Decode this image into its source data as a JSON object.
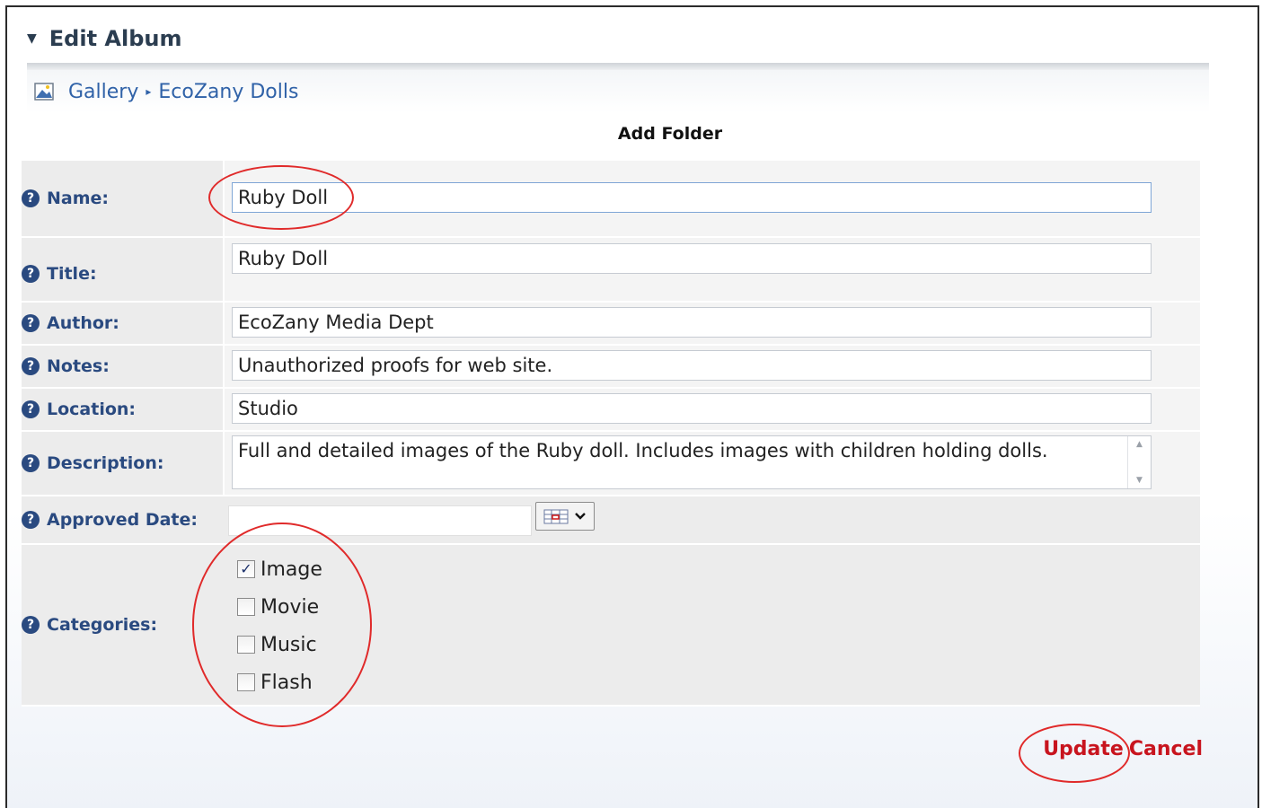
{
  "header": {
    "caret": "▼",
    "title": "Edit Album"
  },
  "breadcrumb": {
    "items": [
      "Gallery",
      "EcoZany Dolls"
    ],
    "separator": "▸"
  },
  "form": {
    "title": "Add Folder",
    "fields": {
      "name": {
        "label": "Name:",
        "value": "Ruby Doll"
      },
      "title": {
        "label": "Title:",
        "value": "Ruby Doll"
      },
      "author": {
        "label": "Author:",
        "value": "EcoZany Media Dept"
      },
      "notes": {
        "label": "Notes:",
        "value": "Unauthorized proofs for web site."
      },
      "location": {
        "label": "Location:",
        "value": "Studio"
      },
      "description": {
        "label": "Description:",
        "value": "Full and detailed images of the Ruby doll. Includes images with children holding dolls."
      },
      "approved_date": {
        "label": "Approved Date:",
        "value": ""
      },
      "categories": {
        "label": "Categories:",
        "options": [
          {
            "label": "Image",
            "checked": true
          },
          {
            "label": "Movie",
            "checked": false
          },
          {
            "label": "Music",
            "checked": false
          },
          {
            "label": "Flash",
            "checked": false
          }
        ]
      }
    }
  },
  "actions": {
    "update": "Update",
    "cancel": "Cancel"
  },
  "help_glyph": "?",
  "check_glyph": "✓",
  "colors": {
    "label": "#2a4a80",
    "link": "#3062a8",
    "action": "#c8141e",
    "annotation": "#e02a2a"
  }
}
